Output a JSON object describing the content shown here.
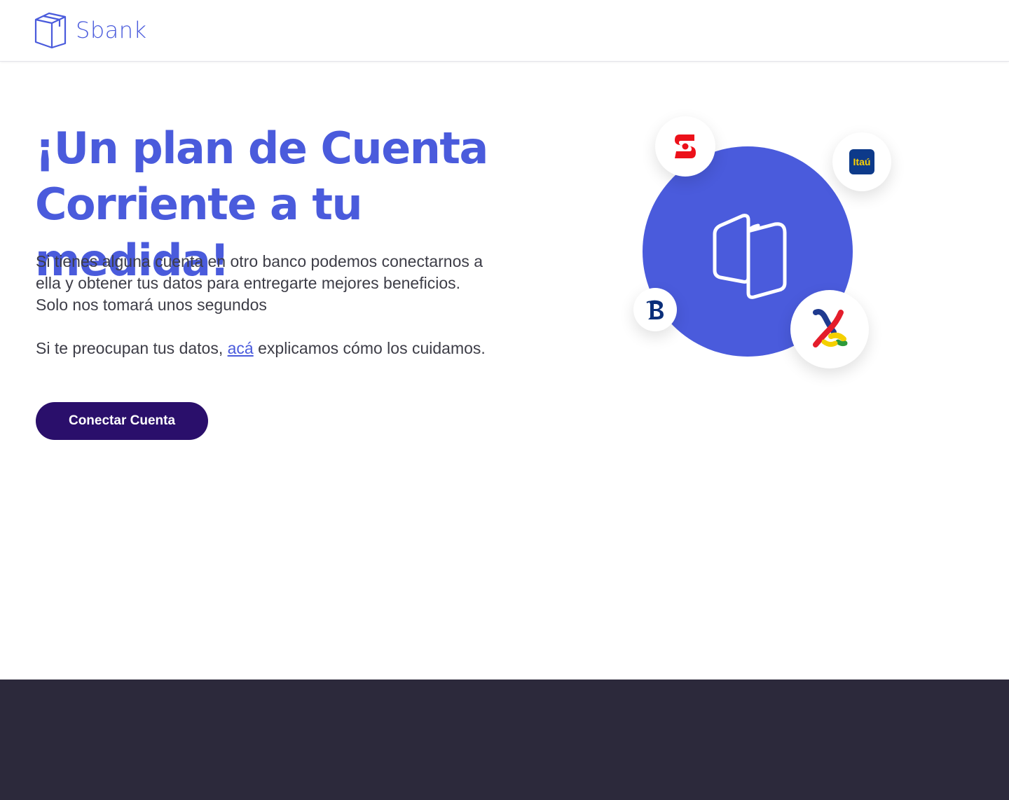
{
  "brand": {
    "name": "Sbank"
  },
  "hero": {
    "title_line1": "¡Un plan de Cuenta",
    "title_line2": "Corriente a tu medida!",
    "text_line1": "Si tienes alguna cuenta en otro banco podemos conectarnos a",
    "text_line2": "ella y obtener tus datos para entregarte mejores beneficios.",
    "text_line3": "Solo nos tomará unos segundos",
    "note_before": "Si te preocupan tus datos, ",
    "note_link": "acá",
    "note_after": " explicamos cómo los cuidamos.",
    "cta_label": "Conectar Cuenta"
  },
  "banks": {
    "itau_label": "Itaú"
  },
  "colors": {
    "primary": "#4a5bdc",
    "cta": "#2a0f6b",
    "footer": "#2c293b"
  },
  "icons": [
    "sbank-logo-icon",
    "scotiabank-logo-icon",
    "itau-logo-icon",
    "bice-logo-icon",
    "falabella-logo-icon"
  ]
}
